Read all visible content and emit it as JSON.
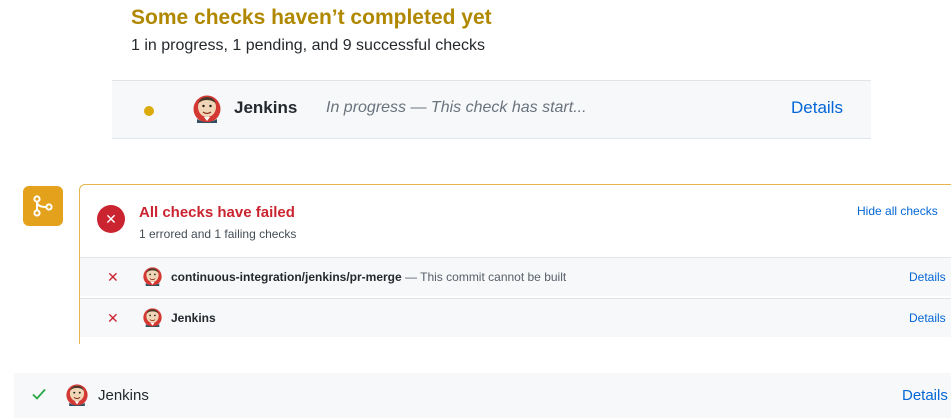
{
  "pending_panel": {
    "title": "Some checks haven’t completed yet",
    "summary": "1 in progress, 1 pending, and 9 successful checks",
    "status_color": "#dbab09",
    "check": {
      "name": "Jenkins",
      "description": "In progress — This check has start...",
      "details_label": "Details",
      "avatar_icon": "jenkins-avatar-icon"
    }
  },
  "failed_panel": {
    "badge_icon": "git-merge-icon",
    "status_icon": "x-circle-icon",
    "title": "All checks have failed",
    "summary": "1 errored and 1 failing checks",
    "hide_label": "Hide all checks",
    "status_color": "#cb2431",
    "checks": [
      {
        "status_icon": "x-icon",
        "name": "continuous-integration/jenkins/pr-merge",
        "separator": " — ",
        "description": "This commit cannot be built",
        "details_label": "Details"
      },
      {
        "status_icon": "x-icon",
        "name": "Jenkins",
        "details_label": "Details"
      }
    ]
  },
  "success_panel": {
    "status_color": "#28a745",
    "check": {
      "status_icon": "check-icon",
      "name": "Jenkins",
      "details_label": "Details"
    }
  },
  "colors": {
    "link": "#0366d6",
    "warning_accent": "#b08800",
    "badge": "#e4a11b"
  }
}
